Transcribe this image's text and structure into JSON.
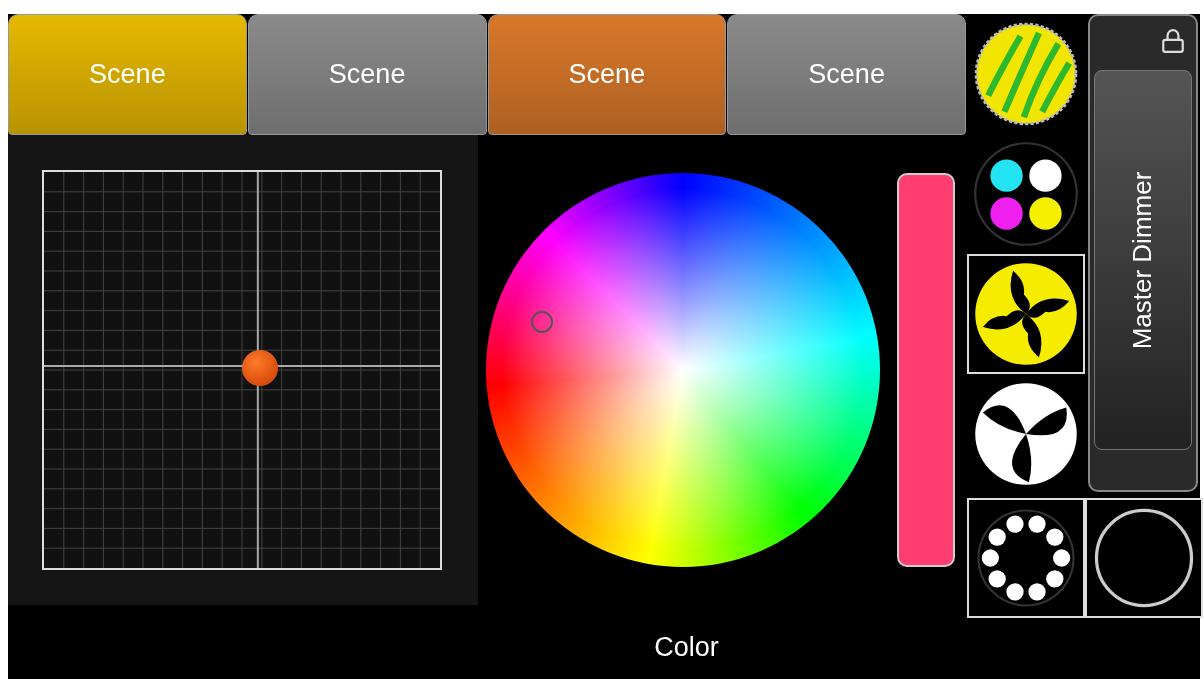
{
  "scenes": [
    {
      "label": "Scene",
      "color": "#e6b800"
    },
    {
      "label": "Scene",
      "color": "#8a8a8a"
    },
    {
      "label": "Scene",
      "color": "#d9782a"
    },
    {
      "label": "Scene",
      "color": "#8a8a8a"
    }
  ],
  "color_section": {
    "label": "Color"
  },
  "master_dimmer": {
    "label": "Master Dimmer",
    "locked": true
  },
  "gobos": [
    {
      "kind": "stripes",
      "framed": false
    },
    {
      "kind": "dots",
      "framed": false
    },
    {
      "kind": "spiral",
      "framed": true
    },
    {
      "kind": "propeller",
      "framed": false
    },
    {
      "kind": "ring",
      "framed": true
    },
    {
      "kind": "open",
      "framed": true
    }
  ]
}
